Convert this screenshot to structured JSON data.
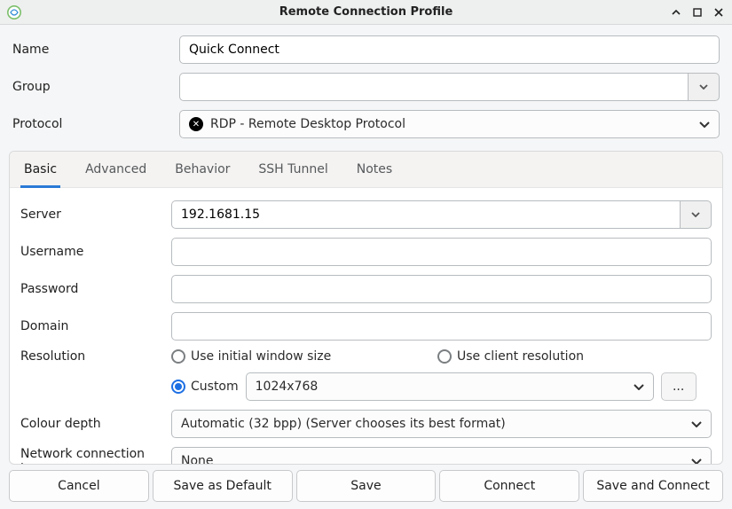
{
  "window": {
    "title": "Remote Connection Profile"
  },
  "header": {
    "name_label": "Name",
    "name_value": "Quick Connect",
    "group_label": "Group",
    "group_value": "",
    "protocol_label": "Protocol",
    "protocol_value": "RDP - Remote Desktop Protocol"
  },
  "tabs": {
    "basic": "Basic",
    "advanced": "Advanced",
    "behavior": "Behavior",
    "ssh": "SSH Tunnel",
    "notes": "Notes",
    "active": "basic"
  },
  "basic": {
    "server_label": "Server",
    "server_value": "192.1681.15",
    "username_label": "Username",
    "username_value": "",
    "password_label": "Password",
    "password_value": "",
    "domain_label": "Domain",
    "domain_value": "",
    "resolution_label": "Resolution",
    "resolution": {
      "initial": "Use initial window size",
      "client": "Use client resolution",
      "custom_label": "Custom",
      "custom_value": "1024x768",
      "more_label": "...",
      "selected": "custom"
    },
    "colour_depth_label": "Colour depth",
    "colour_depth_value": "Automatic (32 bpp) (Server chooses its best format)",
    "netconn_label": "Network connection type",
    "netconn_value": "None"
  },
  "footer": {
    "cancel": "Cancel",
    "save_default": "Save as Default",
    "save": "Save",
    "connect": "Connect",
    "save_connect": "Save and Connect"
  }
}
